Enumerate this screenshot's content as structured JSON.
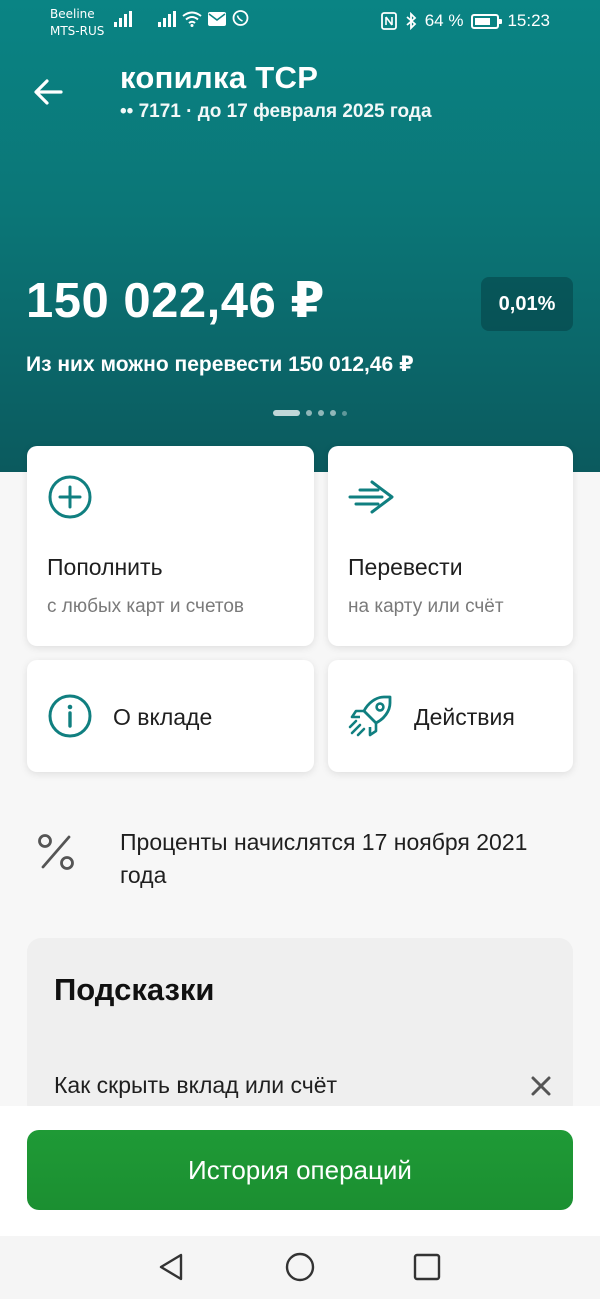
{
  "status_bar": {
    "carrier1": "Beeline",
    "carrier2": "MTS-RUS",
    "battery": "64 %",
    "time": "15:23",
    "icons": [
      "signal-icon",
      "signal-icon",
      "wifi-icon",
      "mail-icon",
      "viber-icon",
      "nfc-icon",
      "bluetooth-icon",
      "battery-icon"
    ]
  },
  "header": {
    "title": "копилка ТСР",
    "subtitle": "•• 7171 · до 17 февраля 2025 года",
    "back_icon": "arrow-left-icon"
  },
  "account": {
    "balance": "150 022,46 ₽",
    "rate": "0,01%",
    "transferable": "Из них можно перевести 150 012,46 ₽"
  },
  "actions": {
    "top_up": {
      "title": "Пополнить",
      "subtitle": "с любых карт и счетов",
      "icon": "plus-circle-icon"
    },
    "transfer": {
      "title": "Перевести",
      "subtitle": "на карту или счёт",
      "icon": "arrow-right-icon"
    },
    "about": {
      "title": "О вкладе",
      "icon": "info-icon"
    },
    "actions": {
      "title": "Действия",
      "icon": "rocket-icon"
    }
  },
  "interest": {
    "text": "Проценты начислятся 17 ноября 2021 года",
    "icon": "percent-icon"
  },
  "tips": {
    "title": "Подсказки",
    "item": "Как скрыть вклад или счёт",
    "close_icon": "close-icon"
  },
  "footer": {
    "history_button": "История операций"
  },
  "colors": {
    "accent": "#0b7677",
    "primary_button": "#21a038",
    "icon_teal": "#107f80"
  }
}
